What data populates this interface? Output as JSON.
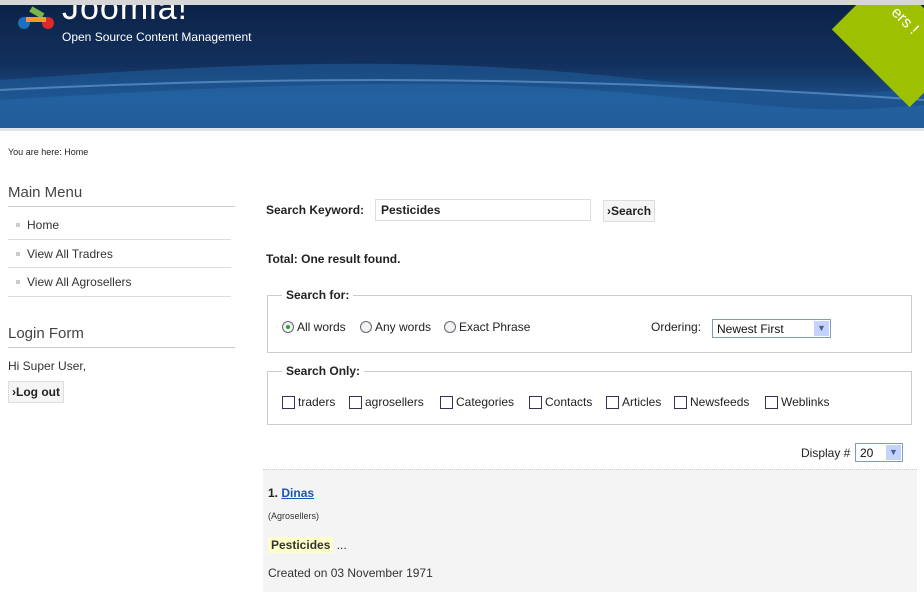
{
  "header": {
    "logo": "Joomla!",
    "tagline": "Open Source Content Management",
    "ribbon": "ers !"
  },
  "breadcrumb": "You are here: Home",
  "sidebar": {
    "menu_title": "Main Menu",
    "items": [
      {
        "label": "Home"
      },
      {
        "label": "View All Tradres"
      },
      {
        "label": "View All Agrosellers"
      }
    ],
    "login_title": "Login Form",
    "greeting": "Hi Super User,",
    "logout": "›Log out"
  },
  "search": {
    "keyword_label": "Search Keyword:",
    "keyword_value": "Pesticides",
    "button": "›Search",
    "total": "Total: One result found.",
    "search_for": "Search for:",
    "options": [
      "All words",
      "Any words",
      "Exact Phrase"
    ],
    "selected_option": "All words",
    "ordering_label": "Ordering:",
    "ordering_value": "Newest First",
    "search_only": "Search Only:",
    "areas": [
      "traders",
      "agrosellers",
      "Categories",
      "Contacts",
      "Articles",
      "Newsfeeds",
      "Weblinks"
    ],
    "display_label": "Display #",
    "display_value": "20"
  },
  "results": [
    {
      "number": "1.",
      "title": "Dinas",
      "section": "(Agrosellers)",
      "snippet_highlight": "Pesticides",
      "snippet_rest": "...",
      "created": "Created on 03 November 1971"
    }
  ],
  "colors": {
    "header": "#13315e",
    "ribbon": "#9dc100",
    "link": "#1b57b1",
    "highlight": "#ffffcc"
  }
}
